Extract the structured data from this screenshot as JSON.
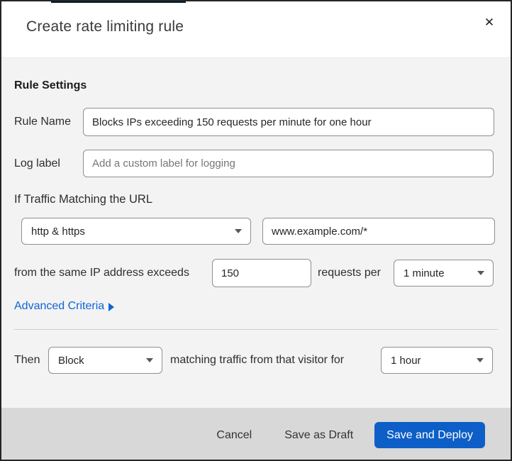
{
  "modal": {
    "title": "Create rate limiting rule",
    "close_icon": "✕"
  },
  "sections": {
    "rule_settings_heading": "Rule Settings",
    "traffic_heading": "If Traffic Matching the URL"
  },
  "fields": {
    "rule_name": {
      "label": "Rule Name",
      "value": "Blocks IPs exceeding 150 requests per minute for one hour"
    },
    "log_label": {
      "label": "Log label",
      "placeholder": "Add a custom label for logging"
    },
    "scheme_select": {
      "value": "http & https"
    },
    "url_input": {
      "value": "www.example.com/*"
    },
    "requests_input": {
      "value": "150"
    },
    "period_select": {
      "value": "1 minute"
    },
    "action_select": {
      "value": "Block"
    },
    "duration_select": {
      "value": "1 hour"
    }
  },
  "rows": {
    "threshold": {
      "prefix": "from the same IP address exceeds",
      "suffix": "requests per"
    },
    "action": {
      "then_label": "Then",
      "suffix": "matching traffic from that visitor for"
    }
  },
  "links": {
    "advanced_criteria": "Advanced Criteria"
  },
  "footer": {
    "cancel_label": "Cancel",
    "save_draft_label": "Save as Draft",
    "save_deploy_label": "Save and Deploy"
  },
  "colors": {
    "primary_button_blue": "#0d5fc7",
    "link_blue": "#1064d6",
    "body_background": "#f3f3f3",
    "footer_background": "#d8d8d8",
    "input_border": "#8f8f8f",
    "top_edge_navy": "#001a2c"
  }
}
